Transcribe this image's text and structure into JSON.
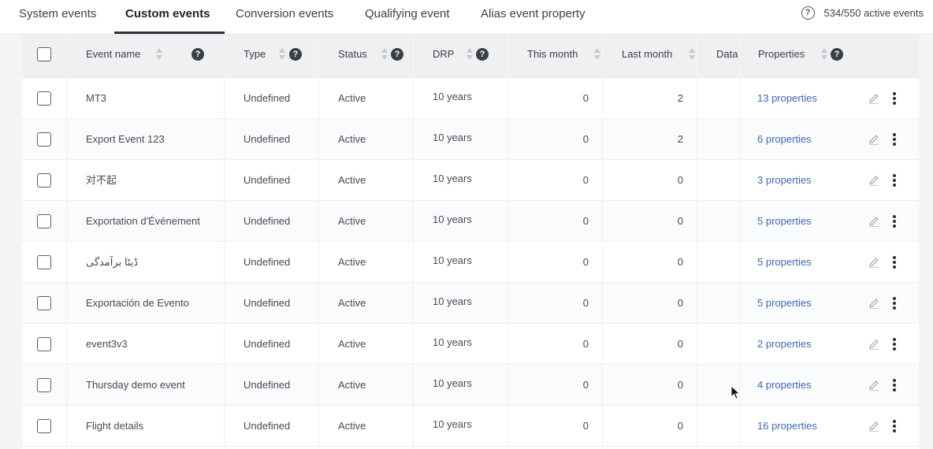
{
  "tabs": [
    {
      "label": "System events",
      "active": false
    },
    {
      "label": "Custom events",
      "active": true
    },
    {
      "label": "Conversion events",
      "active": false
    },
    {
      "label": "Qualifying event",
      "active": false
    },
    {
      "label": "Alias event property",
      "active": false
    }
  ],
  "active_events": {
    "icon": "help-circle-icon",
    "help_glyph": "?",
    "text": "534/550 active events"
  },
  "table": {
    "columns": {
      "event_name": "Event name",
      "type": "Type",
      "status": "Status",
      "drp": "DRP",
      "this_month": "This month",
      "last_month": "Last month",
      "data": "Data",
      "properties": "Properties"
    },
    "help_glyph": "?",
    "rows": [
      {
        "name": "MT3",
        "type": "Undefined",
        "status": "Active",
        "drp": "10 years",
        "this_month": "0",
        "last_month": "2",
        "properties": "13 properties"
      },
      {
        "name": "Export Event 123",
        "type": "Undefined",
        "status": "Active",
        "drp": "10 years",
        "this_month": "0",
        "last_month": "2",
        "properties": "6 properties"
      },
      {
        "name": "对不起",
        "type": "Undefined",
        "status": "Active",
        "drp": "10 years",
        "this_month": "0",
        "last_month": "0",
        "properties": "3 properties"
      },
      {
        "name": "Exportation d'Événement",
        "type": "Undefined",
        "status": "Active",
        "drp": "10 years",
        "this_month": "0",
        "last_month": "0",
        "properties": "5 properties"
      },
      {
        "name": "ڈیٹا برآمدگی",
        "type": "Undefined",
        "status": "Active",
        "drp": "10 years",
        "this_month": "0",
        "last_month": "0",
        "properties": "5 properties"
      },
      {
        "name": "Exportación de Evento",
        "type": "Undefined",
        "status": "Active",
        "drp": "10 years",
        "this_month": "0",
        "last_month": "0",
        "properties": "5 properties"
      },
      {
        "name": "event3v3",
        "type": "Undefined",
        "status": "Active",
        "drp": "10 years",
        "this_month": "0",
        "last_month": "0",
        "properties": "2 properties"
      },
      {
        "name": "Thursday demo event",
        "type": "Undefined",
        "status": "Active",
        "drp": "10 years",
        "this_month": "0",
        "last_month": "0",
        "properties": "4 properties"
      },
      {
        "name": "Flight details",
        "type": "Undefined",
        "status": "Active",
        "drp": "10 years",
        "this_month": "0",
        "last_month": "0",
        "properties": "16 properties"
      }
    ]
  },
  "colors": {
    "accent_link": "#3f68b5",
    "header_bg": "#eef0f2",
    "help_badge": "#3a3e45"
  }
}
